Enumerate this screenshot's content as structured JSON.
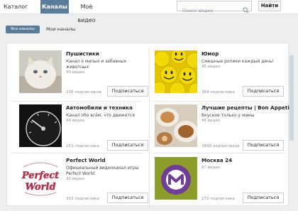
{
  "top_nav": {
    "tabs": [
      {
        "label": "Каталог"
      },
      {
        "label": "Каналы"
      },
      {
        "label": "Моё видео"
      }
    ],
    "search_placeholder": "Поиск видео",
    "search_button": "Найти"
  },
  "sub_nav": {
    "all_channels": "Все каналы",
    "my_channels": "Мои каналы"
  },
  "channels": [
    {
      "title": "Пушистики",
      "description": "Канал о милых и забавных животных",
      "videos": "49 видео",
      "subscribers": "236 подписчиков",
      "button": "Подписаться",
      "thumb": "kitten"
    },
    {
      "title": "Юмор",
      "description": "Смешные ролики каждый день!",
      "videos": "45 видео",
      "subscribers": "364 подписчика",
      "button": "Подписаться",
      "thumb": "smileys"
    },
    {
      "title": "Автомобили и техника",
      "description": "Канал обо всём, что движется",
      "videos": "94 видео",
      "subscribers": "153 подписчика",
      "button": "Подписаться",
      "thumb": "dashboard"
    },
    {
      "title": "Лучшие рецепты | Bon Appetit",
      "description": "Вкусное только у мамы",
      "videos": "45 видео",
      "subscribers": "3899 подписчиков",
      "button": "Подписаться",
      "thumb": "food"
    },
    {
      "title": "Perfect World",
      "description": "Официальный видеоканал игры Perfect World",
      "videos": "30 видео",
      "subscribers": "303 подписчика",
      "button": "Подписаться",
      "thumb": "perfect-world-logo",
      "logo_text": "Perfect World"
    },
    {
      "title": "Москва 24",
      "description": "",
      "videos": "87 видео",
      "subscribers": "272 подписчика",
      "button": "Подписаться",
      "thumb": "moskva24-logo"
    }
  ],
  "colors": {
    "accent": "#5a7c99",
    "background": "#edeef0"
  }
}
